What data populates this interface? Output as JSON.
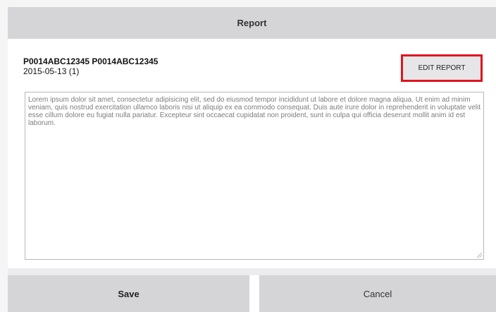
{
  "dialog": {
    "title": "Report"
  },
  "report": {
    "id_line": "P0014ABC12345 P0014ABC12345",
    "date_line": "2015-05-13 (1)",
    "edit_button_label": "EDIT REPORT",
    "body_text": "Lorem ipsum dolor sit amet, consectetur adipisicing elit, sed do eiusmod tempor incididunt ut labore et dolore magna aliqua. Ut enim ad minim veniam, quis nostrud exercitation ullamco laboris nisi ut aliquip ex ea commodo consequat. Duis aute irure dolor in reprehenderit in voluptate velit esse cillum dolore eu fugiat nulla pariatur. Excepteur sint occaecat cupidatat non proident, sunt in culpa qui officia deserunt mollit anim id est laborum."
  },
  "footer": {
    "save_label": "Save",
    "cancel_label": "Cancel"
  },
  "colors": {
    "header_bg": "#d5d5d8",
    "highlight_border": "#e0141e",
    "button_bg": "#d5d5d8"
  }
}
